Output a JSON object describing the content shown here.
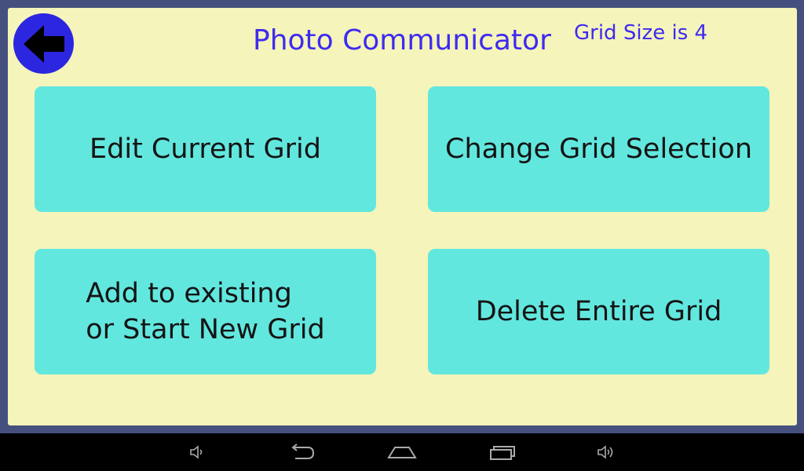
{
  "header": {
    "title": "Photo Communicator",
    "grid_size_text": "Grid Size is 4",
    "back_icon": "arrow-left-icon"
  },
  "actions": {
    "edit_current_grid": "Edit Current Grid",
    "change_grid_selection": "Change Grid Selection",
    "add_line1": "Add to existing",
    "add_line2": "or Start New Grid",
    "delete_entire_grid": "Delete Entire Grid"
  },
  "navbar": {
    "icons": [
      "volume-down-icon",
      "back-icon",
      "home-icon",
      "recent-apps-icon",
      "volume-up-icon"
    ]
  },
  "colors": {
    "panel_bg": "#f5f4bb",
    "frame": "#46507f",
    "button_bg": "#62e7df",
    "title_text": "#3e2bf0",
    "back_button": "#2d26e0"
  }
}
